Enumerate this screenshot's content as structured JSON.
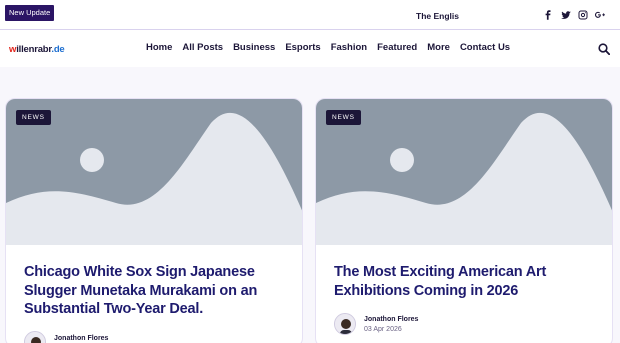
{
  "topbar": {
    "update_label": "New Update",
    "ticker_text": "The Englis",
    "social": [
      "facebook-icon",
      "twitter-icon",
      "instagram-icon",
      "google-plus-icon"
    ]
  },
  "logo": {
    "part1": "w",
    "part2": "illenrabr",
    "part3": ".de"
  },
  "nav": {
    "items": [
      "Home",
      "All Posts",
      "Business",
      "Esports",
      "Fashion",
      "Featured",
      "More",
      "Contact Us"
    ]
  },
  "cards": [
    {
      "tag": "NEWS",
      "title": "Chicago White Sox Sign Japanese Slugger Munetaka Murakami on an Substantial Two-Year Deal.",
      "author": "Jonathon Flores",
      "date": ""
    },
    {
      "tag": "NEWS",
      "title": "The Most Exciting American Art Exhibitions Coming in 2026",
      "author": "Jonathon Flores",
      "date": "03 Apr 2026"
    }
  ],
  "colors": {
    "accent": "#2b1565",
    "title": "#1e1b6e",
    "placeholder_bg": "#8d99a6",
    "placeholder_fg": "#e5e8ee"
  }
}
